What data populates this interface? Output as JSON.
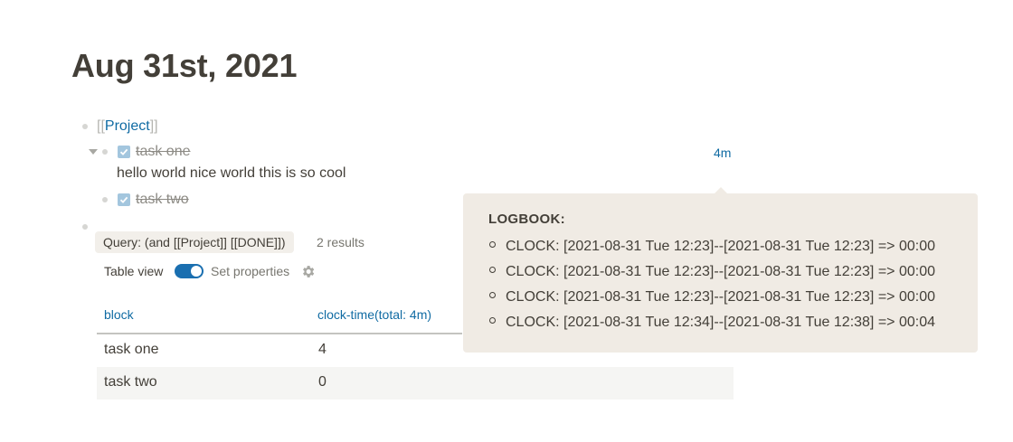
{
  "page": {
    "title": "Aug 31st, 2021"
  },
  "blocks": {
    "project_ref": {
      "open": "[[",
      "name": "Project",
      "close": "]]"
    },
    "task_one": {
      "label": "task one",
      "note": "hello world nice world this is so cool",
      "clock": "4m"
    },
    "task_two": {
      "label": "task two"
    }
  },
  "query": {
    "text": "Query: (and [[Project]] [[DONE]])",
    "results": "2 results",
    "table_view_label": "Table view",
    "set_properties_label": "Set properties",
    "columns": [
      "block",
      "clock-time(total: 4m)"
    ],
    "rows": [
      {
        "block": "task one",
        "clock": "4"
      },
      {
        "block": "task two",
        "clock": "0"
      }
    ]
  },
  "logbook": {
    "title": "LOGBOOK:",
    "entries": [
      "CLOCK: [2021-08-31 Tue 12:23]--[2021-08-31 Tue 12:23] => 00:00",
      "CLOCK: [2021-08-31 Tue 12:23]--[2021-08-31 Tue 12:23] => 00:00",
      "CLOCK: [2021-08-31 Tue 12:23]--[2021-08-31 Tue 12:23] => 00:00",
      "CLOCK: [2021-08-31 Tue 12:34]--[2021-08-31 Tue 12:38] => 00:04"
    ]
  },
  "colors": {
    "link": "#106ba3",
    "popup_bg": "#f0ebe4",
    "toggle_on": "#1a6fb0"
  }
}
